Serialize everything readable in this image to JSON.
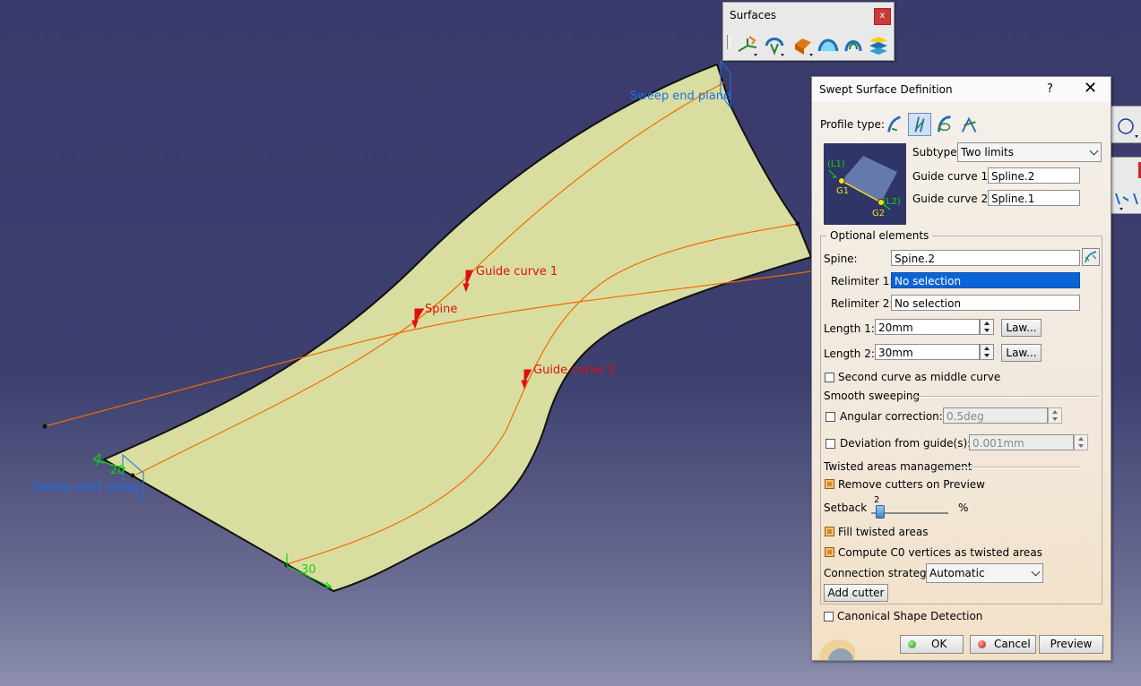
{
  "viewport": {
    "labels": {
      "guide_curve_1": "Guide curve 1",
      "guide_curve_2": "Guide curve 2",
      "spine": "Spine",
      "sweep_end_plane": "Sweep end plane",
      "sweep_start_plane": "Sweep start plane",
      "length_20": "20",
      "length_30": "30"
    },
    "colors": {
      "surface": "#d9dea0",
      "curve": "#f26a00",
      "label_red": "#e01010",
      "label_blue": "#1e6fe0",
      "manip_green": "#14d014"
    }
  },
  "toolbar": {
    "title": "Surfaces",
    "close": "x",
    "icons": [
      "extrude-icon",
      "revolve-icon",
      "sphere-icon",
      "sweep-icon",
      "fill-icon",
      "multisection-icon"
    ]
  },
  "dialog": {
    "title": "Swept Surface Definition",
    "help": "?",
    "close": "✕",
    "profile_type_label": "Profile type:",
    "profile_type_icons": [
      "explicit-profile-icon",
      "linear-profile-icon",
      "circle-profile-icon",
      "conic-profile-icon"
    ],
    "preview_labels": {
      "l1": "(L1)",
      "g1": "G1",
      "l2": "(L2)",
      "g2": "G2"
    },
    "subtype_label": "Subtype:",
    "subtype_value": "Two limits",
    "guide1_label": "Guide curve 1:",
    "guide1_value": "Spline.2",
    "guide2_label": "Guide curve 2:",
    "guide2_value": "Spline.1",
    "optional_elements": "Optional elements",
    "spine_label": "Spine:",
    "spine_value": "Spine.2",
    "relimiter1_label": "Relimiter 1:",
    "relimiter1_value": "No selection",
    "relimiter2_label": "Relimiter 2:",
    "relimiter2_value": "No selection",
    "length1_label": "Length 1:",
    "length1_value": "20mm",
    "length2_label": "Length 2:",
    "length2_value": "30mm",
    "law_label": "Law...",
    "second_curve_label": "Second curve as middle curve",
    "smooth_sweeping": "Smooth sweeping",
    "angular_label": "Angular correction:",
    "angular_value": "0.5deg",
    "deviation_label": "Deviation from guide(s):",
    "deviation_value": "0.001mm",
    "twisted_areas": "Twisted areas management",
    "remove_cutters_label": "Remove cutters on Preview",
    "setback_label": "Setback",
    "setback_value": "2",
    "setback_fraction": 0.02,
    "percent": "%",
    "fill_twisted_label": "Fill twisted areas",
    "compute_c0_label": "Compute C0 vertices as twisted areas",
    "connection_label": "Connection strategy:",
    "connection_value": "Automatic",
    "add_cutter": "Add cutter",
    "canonical_label": "Canonical Shape Detection",
    "ok": "OK",
    "cancel": "Cancel",
    "preview": "Preview"
  }
}
